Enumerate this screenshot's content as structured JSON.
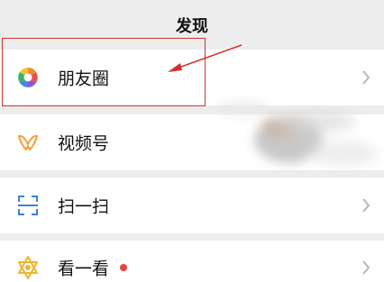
{
  "header": {
    "title": "发现"
  },
  "items": [
    {
      "label": "朋友圈",
      "icon": "moments-icon"
    },
    {
      "label": "视频号",
      "icon": "channels-icon"
    },
    {
      "label": "扫一扫",
      "icon": "scan-icon"
    },
    {
      "label": "看一看",
      "icon": "top-stories-icon",
      "has_badge": true
    }
  ],
  "colors": {
    "background": "#ededed",
    "row": "#ffffff",
    "highlight": "#d0322f",
    "badge": "#e64340",
    "chevron": "#b2b2b2"
  }
}
